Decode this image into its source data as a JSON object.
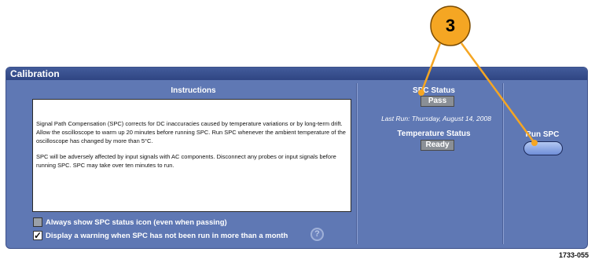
{
  "panel": {
    "title": "Calibration"
  },
  "instructions": {
    "label": "Instructions",
    "paragraph1": "Signal Path Compensation (SPC) corrects for DC inaccuracies caused by temperature variations or by long-term drift. Allow the oscilloscope to warm up 20 minutes before running SPC. Run SPC whenever the ambient temperature of the oscilloscope has changed by more than 5°C.",
    "paragraph2": "SPC will be adversely affected by input signals with AC components. Disconnect any probes or input signals before running SPC. SPC may take over ten minutes to run."
  },
  "options": {
    "always_show_label": "Always show SPC status icon (even when passing)",
    "always_show_checked": false,
    "warning_label": "Display a warning when SPC has not been run in more than a month",
    "warning_checked": true,
    "help_glyph": "?"
  },
  "spc_status": {
    "label": "SPC Status",
    "value": "Pass",
    "last_run": "Last Run: Thursday, August 14, 2008"
  },
  "temperature_status": {
    "label": "Temperature Status",
    "value": "Ready"
  },
  "run_spc": {
    "label": "Run SPC"
  },
  "callout": {
    "number": "3"
  },
  "figure_id": "1733-055",
  "colors": {
    "panel": "#5f78b4",
    "title_bar": "#2f4583",
    "callout_circle": "#f5a623",
    "callout_arrow": "#f5a623",
    "status_box": "#8a8f96"
  }
}
